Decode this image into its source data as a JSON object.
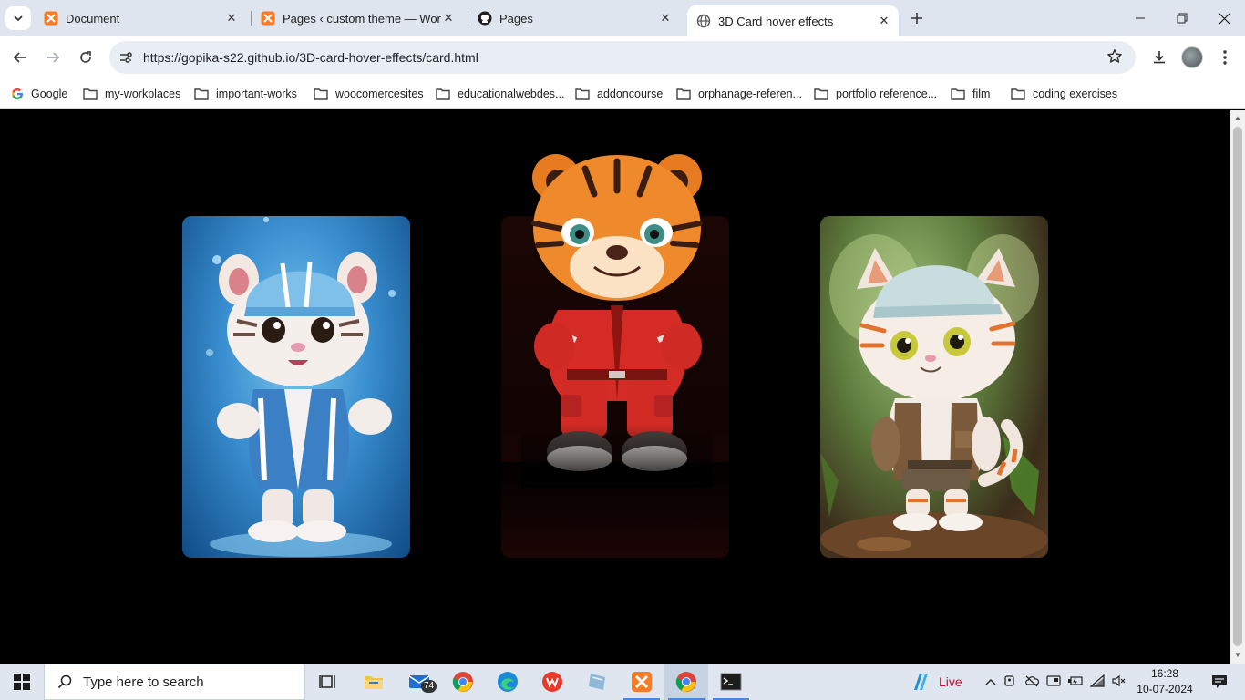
{
  "tabs": [
    {
      "title": "Document",
      "favicon": "xampp-icon",
      "active": false
    },
    {
      "title": "Pages ‹ custom theme — WordPress",
      "favicon": "xampp-icon",
      "active": false
    },
    {
      "title": "Pages",
      "favicon": "github-icon",
      "active": false
    },
    {
      "title": "3D Card hover effects",
      "favicon": "globe-icon",
      "active": true
    }
  ],
  "toolbar": {
    "url": "https://gopika-s22.github.io/3D-card-hover-effects/card.html"
  },
  "bookmarks": [
    {
      "label": "Google",
      "icon": "google-icon"
    },
    {
      "label": "my-workplaces",
      "icon": "folder-icon"
    },
    {
      "label": "important-works",
      "icon": "folder-icon"
    },
    {
      "label": "woocomercesites",
      "icon": "folder-icon"
    },
    {
      "label": "educationalwebdes...",
      "icon": "folder-icon"
    },
    {
      "label": "addoncourse",
      "icon": "folder-icon"
    },
    {
      "label": "orphanage-referen...",
      "icon": "folder-icon"
    },
    {
      "label": "portfolio reference...",
      "icon": "folder-icon"
    },
    {
      "label": "film",
      "icon": "folder-icon"
    },
    {
      "label": "coding exercises",
      "icon": "folder-icon"
    }
  ],
  "cards": [
    {
      "character": "white tiger cub in blue cap and blue jacket",
      "hovered": false
    },
    {
      "character": "orange tiger in red tracksuit",
      "hovered": true
    },
    {
      "character": "white-orange kitten in cap and brown vest",
      "hovered": false
    }
  ],
  "taskbar": {
    "search_placeholder": "Type here to search",
    "mail_badge": "74",
    "weather_label": "Live",
    "time": "16:28",
    "date": "10-07-2024"
  },
  "colors": {
    "tabstrip": "#dee5ee",
    "page_background": "#000000",
    "taskbar": "#dfe6ef"
  }
}
